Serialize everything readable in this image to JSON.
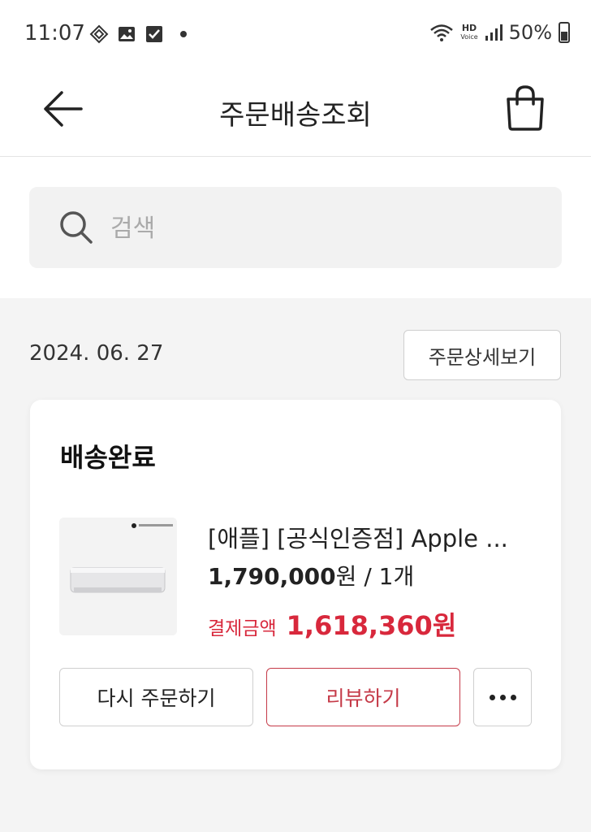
{
  "status_bar": {
    "time": "11:07",
    "hd_label": "HD",
    "voice_label": "Voice",
    "battery": "50%"
  },
  "header": {
    "title": "주문배송조회",
    "icons": {
      "back": "back-arrow-icon",
      "cart": "shopping-bag-icon"
    }
  },
  "search": {
    "placeholder": "검색"
  },
  "order": {
    "date": "2024. 06. 27",
    "detail_button": "주문상세보기",
    "status": "배송완료",
    "product": {
      "name": "[애플] [공식인증점] Apple ...",
      "price": "1,790,000",
      "price_unit": "원",
      "quantity": "/ 1개",
      "pay_label": "결제금액",
      "pay_amount": "1,618,360원"
    },
    "buttons": {
      "reorder": "다시 주문하기",
      "review": "리뷰하기"
    }
  },
  "colors": {
    "accent": "#d8283c",
    "review_border": "#c53a48",
    "page_bg": "#f4f4f4"
  }
}
